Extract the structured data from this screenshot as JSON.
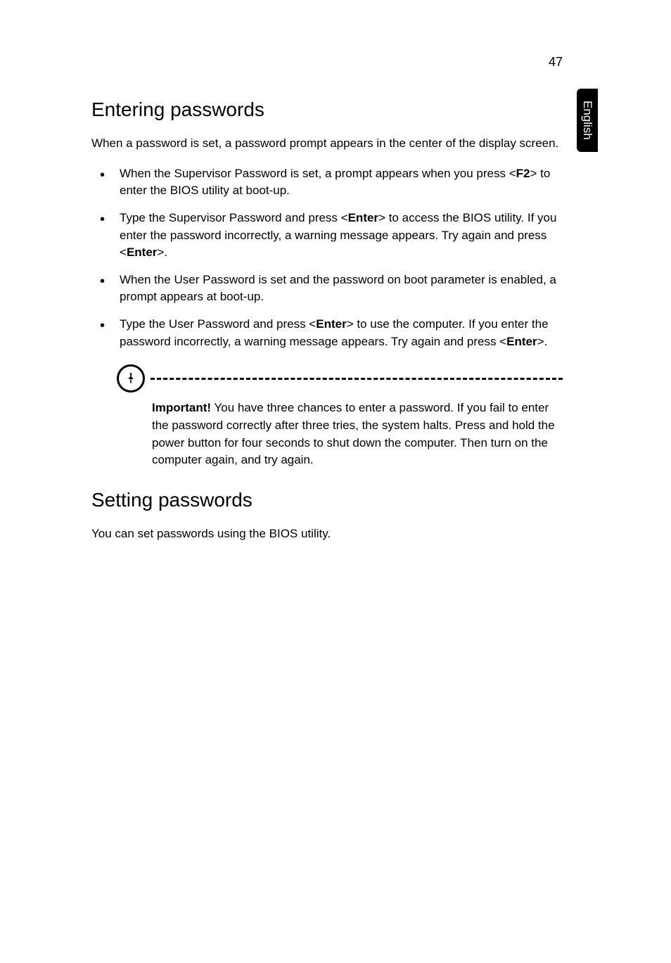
{
  "page_number": "47",
  "side_tab": "English",
  "section1": {
    "heading": "Entering passwords",
    "intro": "When a password is set, a password prompt appears in the center of the display screen.",
    "bullets": [
      {
        "pre": "When the Supervisor Password is set, a prompt appears when you press <",
        "key": "F2",
        "post": "> to enter the BIOS utility at boot-up."
      },
      {
        "pre": "Type the Supervisor Password and press <",
        "key": "Enter",
        "mid": "> to access the BIOS utility. If you enter the password incorrectly, a warning message appears. Try again and press <",
        "key2": "Enter",
        "post": ">."
      },
      {
        "pre": "When the User Password is set and the password on boot parameter is enabled, a prompt appears at boot-up.",
        "key": "",
        "post": ""
      },
      {
        "pre": "Type the User Password and press <",
        "key": "Enter",
        "mid": "> to use the computer. If you enter the password incorrectly, a warning message appears. Try again and press <",
        "key2": "Enter",
        "post": ">."
      }
    ],
    "note": {
      "important_label": "Important!",
      "text": " You have three chances to enter a password. If you fail to enter the password correctly after three tries, the system halts. Press and hold the power button for four seconds to shut down the computer. Then turn on the computer again, and try again."
    }
  },
  "section2": {
    "heading": "Setting passwords",
    "body": "You can set passwords using the BIOS utility."
  }
}
